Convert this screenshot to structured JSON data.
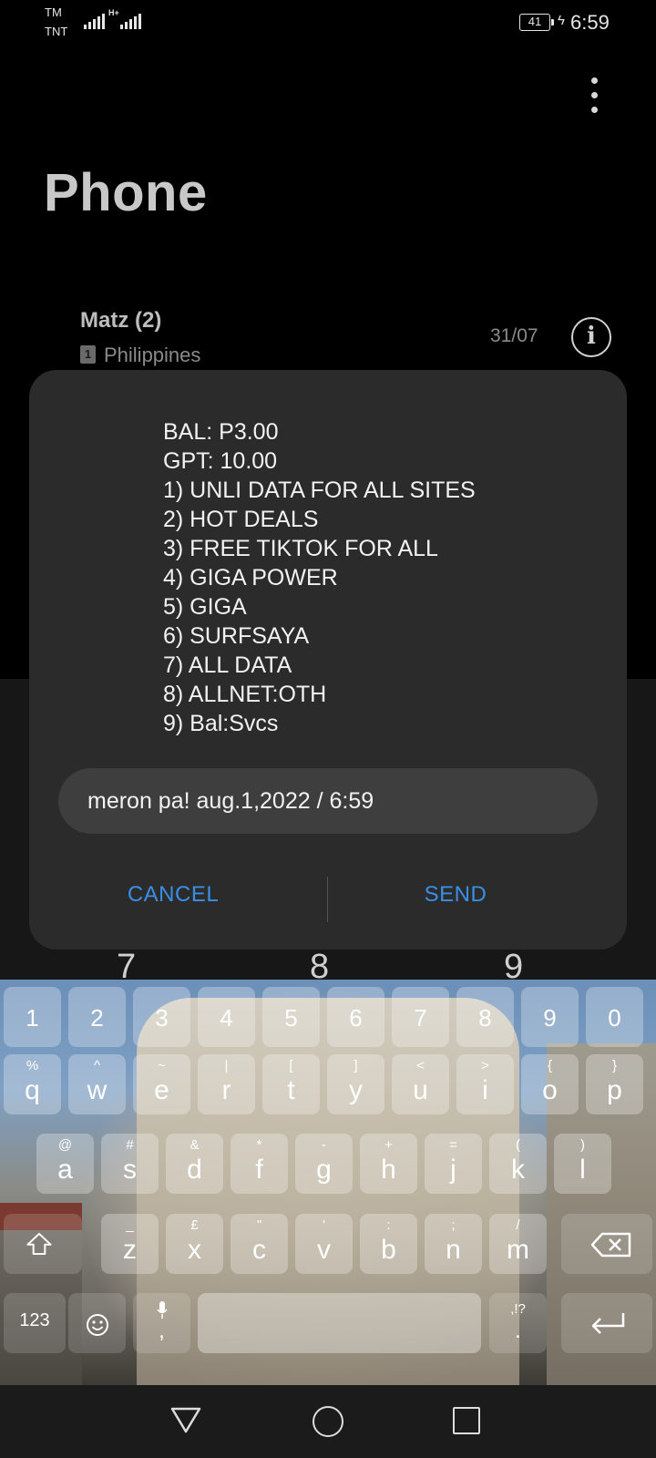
{
  "status_bar": {
    "carrier_1": "TM",
    "carrier_2": "TNT",
    "network_tag": "H+",
    "battery": "41",
    "time": "6:59"
  },
  "app": {
    "title": "Phone",
    "contact": {
      "name": "Matz (2)",
      "sim": "1",
      "location": "Philippines",
      "date": "31/07"
    },
    "dialpad_digits": [
      "7",
      "8",
      "9"
    ]
  },
  "dialog": {
    "lines": [
      "BAL: P3.00",
      "GPT: 10.00",
      "1) UNLI DATA FOR ALL SITES",
      "2) HOT DEALS",
      "3) FREE TIKTOK FOR ALL",
      "4) GIGA POWER",
      "5) GIGA",
      "6) SURFSAYA",
      "7) ALL DATA",
      "8) ALLNET:OTH",
      "9) Bal:Svcs"
    ],
    "reply_value": "meron pa! aug.1,2022 / 6:59",
    "cancel_label": "CANCEL",
    "send_label": "SEND",
    "accent_color": "#3a8ee6"
  },
  "keyboard": {
    "numbers": [
      "1",
      "2",
      "3",
      "4",
      "5",
      "6",
      "7",
      "8",
      "9",
      "0"
    ],
    "row1": [
      {
        "main": "q",
        "sub": "%"
      },
      {
        "main": "w",
        "sub": "^"
      },
      {
        "main": "e",
        "sub": "~"
      },
      {
        "main": "r",
        "sub": "|"
      },
      {
        "main": "t",
        "sub": "["
      },
      {
        "main": "y",
        "sub": "]"
      },
      {
        "main": "u",
        "sub": "<"
      },
      {
        "main": "i",
        "sub": ">"
      },
      {
        "main": "o",
        "sub": "{"
      },
      {
        "main": "p",
        "sub": "}"
      }
    ],
    "row2": [
      {
        "main": "a",
        "sub": "@"
      },
      {
        "main": "s",
        "sub": "#"
      },
      {
        "main": "d",
        "sub": "&"
      },
      {
        "main": "f",
        "sub": "*"
      },
      {
        "main": "g",
        "sub": "-"
      },
      {
        "main": "h",
        "sub": "+"
      },
      {
        "main": "j",
        "sub": "="
      },
      {
        "main": "k",
        "sub": "("
      },
      {
        "main": "l",
        "sub": ")"
      }
    ],
    "row3": [
      {
        "main": "z",
        "sub": "_"
      },
      {
        "main": "x",
        "sub": "£"
      },
      {
        "main": "c",
        "sub": "\""
      },
      {
        "main": "v",
        "sub": "'"
      },
      {
        "main": "b",
        "sub": ":"
      },
      {
        "main": "n",
        "sub": ";"
      },
      {
        "main": "m",
        "sub": "/"
      }
    ],
    "symbols_label": "123",
    "comma": ",",
    "period": ".",
    "punct_hint": ",!?"
  },
  "icons": {
    "more": "more-vert-icon",
    "info": "info-icon",
    "shift": "shift-icon",
    "backspace": "backspace-icon",
    "emoji": "emoji-icon",
    "mic": "mic-icon",
    "enter": "enter-icon",
    "nav_back": "back-triangle-icon",
    "nav_home": "home-circle-icon",
    "nav_recent": "recent-square-icon"
  }
}
